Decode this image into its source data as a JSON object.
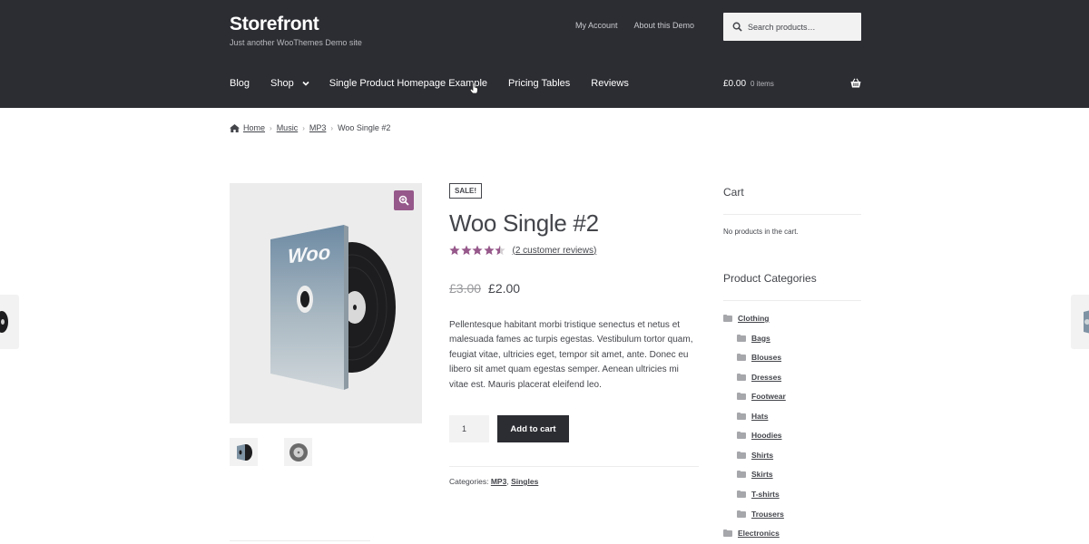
{
  "header": {
    "site_title": "Storefront",
    "site_description": "Just another WooThemes Demo site",
    "secondary_nav": [
      "My Account",
      "About this Demo"
    ],
    "search_placeholder": "Search products…",
    "main_nav": [
      "Blog",
      "Shop",
      "Single Product Homepage Example",
      "Pricing Tables",
      "Reviews"
    ],
    "cart_total": "£0.00",
    "cart_items": "0 items"
  },
  "breadcrumb": {
    "items": [
      "Home",
      "Music",
      "MP3"
    ],
    "current": "Woo Single #2"
  },
  "product": {
    "sale_badge": "SALE!",
    "title": "Woo Single #2",
    "rating": 4.5,
    "reviews_link": "(2 customer reviews)",
    "old_price": "£3.00",
    "new_price": "£2.00",
    "description": "Pellentesque habitant morbi tristique senectus et netus et malesuada fames ac turpis egestas. Vestibulum tortor quam, feugiat vitae, ultricies eget, tempor sit amet, ante. Donec eu libero sit amet quam egestas semper. Aenean ultricies mi vitae est. Mauris placerat eleifend leo.",
    "quantity": "1",
    "add_to_cart": "Add to cart",
    "categories_label": "Categories:",
    "categories": [
      "MP3",
      "Singles"
    ],
    "cover_text": "Woo"
  },
  "sidebar": {
    "cart_title": "Cart",
    "cart_empty": "No products in the cart.",
    "categories_title": "Product Categories",
    "categories": [
      {
        "label": "Clothing",
        "level": 0
      },
      {
        "label": "Bags",
        "level": 1
      },
      {
        "label": "Blouses",
        "level": 1
      },
      {
        "label": "Dresses",
        "level": 1
      },
      {
        "label": "Footwear",
        "level": 1
      },
      {
        "label": "Hats",
        "level": 1
      },
      {
        "label": "Hoodies",
        "level": 1
      },
      {
        "label": "Shirts",
        "level": 1
      },
      {
        "label": "Skirts",
        "level": 1
      },
      {
        "label": "T-shirts",
        "level": 1
      },
      {
        "label": "Trousers",
        "level": 1
      },
      {
        "label": "Electronics",
        "level": 0
      }
    ]
  },
  "colors": {
    "header_bg": "#2c2d33",
    "accent": "#96588a",
    "text": "#43454b"
  }
}
